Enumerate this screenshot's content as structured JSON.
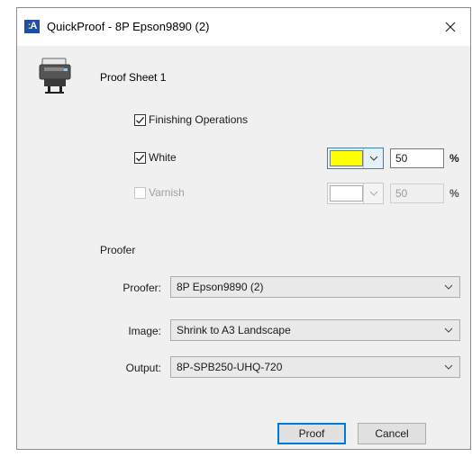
{
  "window": {
    "title": "QuickProof - 8P Epson9890 (2)",
    "app_icon": "app-logo-icon",
    "close_icon": "close-icon"
  },
  "sheet": {
    "title": "Proof Sheet 1"
  },
  "finishing": {
    "label": "Finishing Operations",
    "checked": true,
    "white": {
      "label": "White",
      "checked": true,
      "color": "#ffff00",
      "value": "50",
      "unit": "%"
    },
    "varnish": {
      "label": "Varnish",
      "checked": false,
      "enabled": false,
      "color": "#ffffff",
      "value": "50",
      "unit": "%"
    }
  },
  "proofer_section": {
    "heading": "Proofer",
    "proofer": {
      "label": "Proofer:",
      "value": "8P Epson9890 (2)"
    },
    "image": {
      "label": "Image:",
      "value": "Shrink to A3 Landscape"
    },
    "output": {
      "label": "Output:",
      "value": "8P-SPB250-UHQ-720"
    }
  },
  "buttons": {
    "proof": "Proof",
    "cancel": "Cancel"
  },
  "annotation_color": "#e0262a"
}
